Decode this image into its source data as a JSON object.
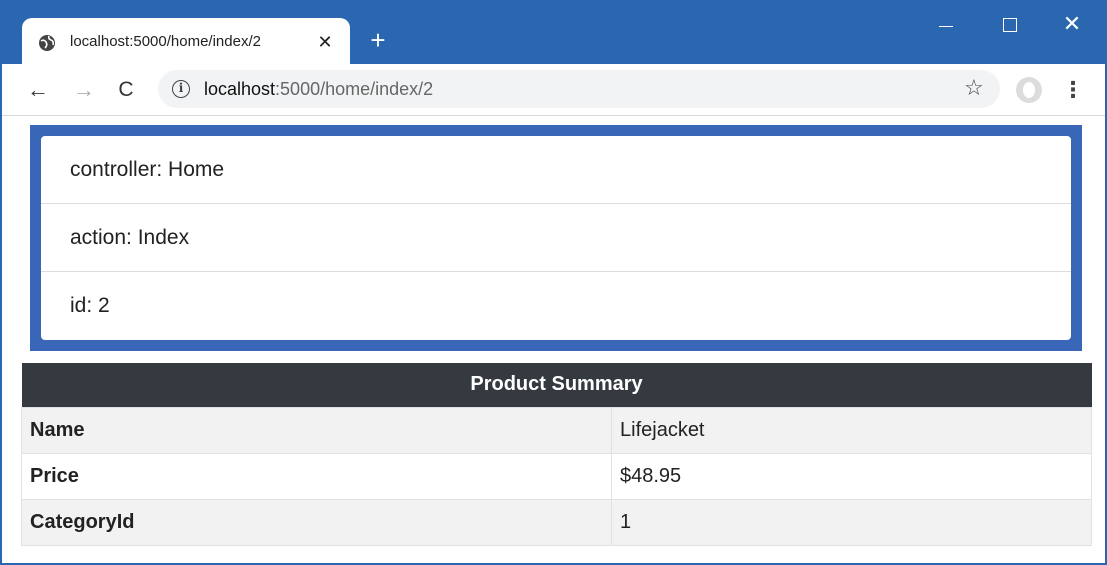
{
  "browser": {
    "tab_title": "localhost:5000/home/index/2",
    "tab_close": "✕",
    "new_tab": "+",
    "window_close": "✕",
    "url_host": "localhost",
    "url_rest": ":5000/home/index/2",
    "back": "←",
    "forward": "→",
    "reload": "C",
    "star": "☆",
    "menu": "⋮",
    "info": "i"
  },
  "route": {
    "items": [
      {
        "label": "controller: Home"
      },
      {
        "label": "action: Index"
      },
      {
        "label": "id: 2"
      }
    ]
  },
  "summary": {
    "heading": "Product Summary",
    "rows": [
      {
        "key": "Name",
        "value": "Lifejacket"
      },
      {
        "key": "Price",
        "value": "$48.95"
      },
      {
        "key": "CategoryId",
        "value": "1"
      }
    ]
  },
  "colors": {
    "titlebar": "#2b66b1",
    "panel_border": "#3a66b8",
    "table_header": "#343a40"
  }
}
